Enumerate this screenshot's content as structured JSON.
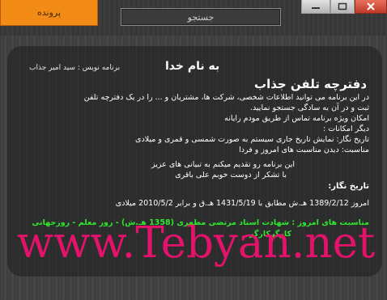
{
  "toolbar": {
    "profile_label": "پرونده",
    "search_value": "جستجو"
  },
  "header": {
    "basmala": "به نام خدا",
    "programmer": "برنامه نویس : سید امیر جذاب"
  },
  "content": {
    "title": "دفترچه تلفن جذاب",
    "lines": [
      "در این برنامه می توانید اطلاعات شخصی، شرکت ها، مشتریان و ... را در یک دفترچه تلفن",
      "ثبت و در آن به سادگی جستجو نمایید.",
      "امکان ویژه برنامه تماس از طریق مودم رایانه",
      "دیگر امکانات :",
      "تاریخ نگار: نمایش تاریخ جاری سیستم به صورت شمسی و قمری و میلادی",
      "مناسبت: دیدن مناسبت های امروز و فردا"
    ],
    "dedication": [
      "این برنامه رو تقدیم میکنم به تبیانی های عزیز",
      "با تشکر از دوست خوبم علی باقری"
    ]
  },
  "date_section": {
    "label": "تاریخ نگار:",
    "value": "امروز 1389/2/12 هـ.ش مطابق با 1431/5/19 هـ.ق و برابر 2010/5/2 میلادی"
  },
  "occasions": {
    "line1": "مناسبت های امروز : شهادت استاد مرتضی مطهری (1358 هـ.ش) - روز معلم - روزجهانی",
    "line2": "کارگرکارگر"
  },
  "watermark": "www.Tebyan.net",
  "colors": {
    "accent": "#f28c16",
    "occasion_green": "#2ee82e",
    "watermark": "#e3126a"
  },
  "icons": [
    "minimize-icon",
    "maximize-icon",
    "close-icon"
  ]
}
